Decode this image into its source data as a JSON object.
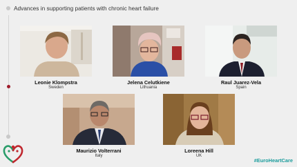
{
  "header": {
    "title": "Advances in supporting patients with chronic heart failure"
  },
  "participants": [
    {
      "name": "Leonie Klompstra",
      "country": "Sweden",
      "background": "#ece9e3"
    },
    {
      "name": "Jelena Celutkiene",
      "country": "Lithuania",
      "background": "#b8a79a"
    },
    {
      "name": "Raul Juarez-Vela",
      "country": "Spain",
      "background": "#e7ece9"
    },
    {
      "name": "Maurizio Volterrani",
      "country": "Italy",
      "background": "#c7a88e"
    },
    {
      "name": "Loreena Hill",
      "country": "UK",
      "background": "#a07a46"
    }
  ],
  "footer": {
    "hashtag": "#EuroHeartCare"
  },
  "colors": {
    "accent": "#9e1a2a",
    "hashtag": "#1a9c9c",
    "logo_green": "#2a9d6a",
    "logo_red": "#c0282f"
  }
}
